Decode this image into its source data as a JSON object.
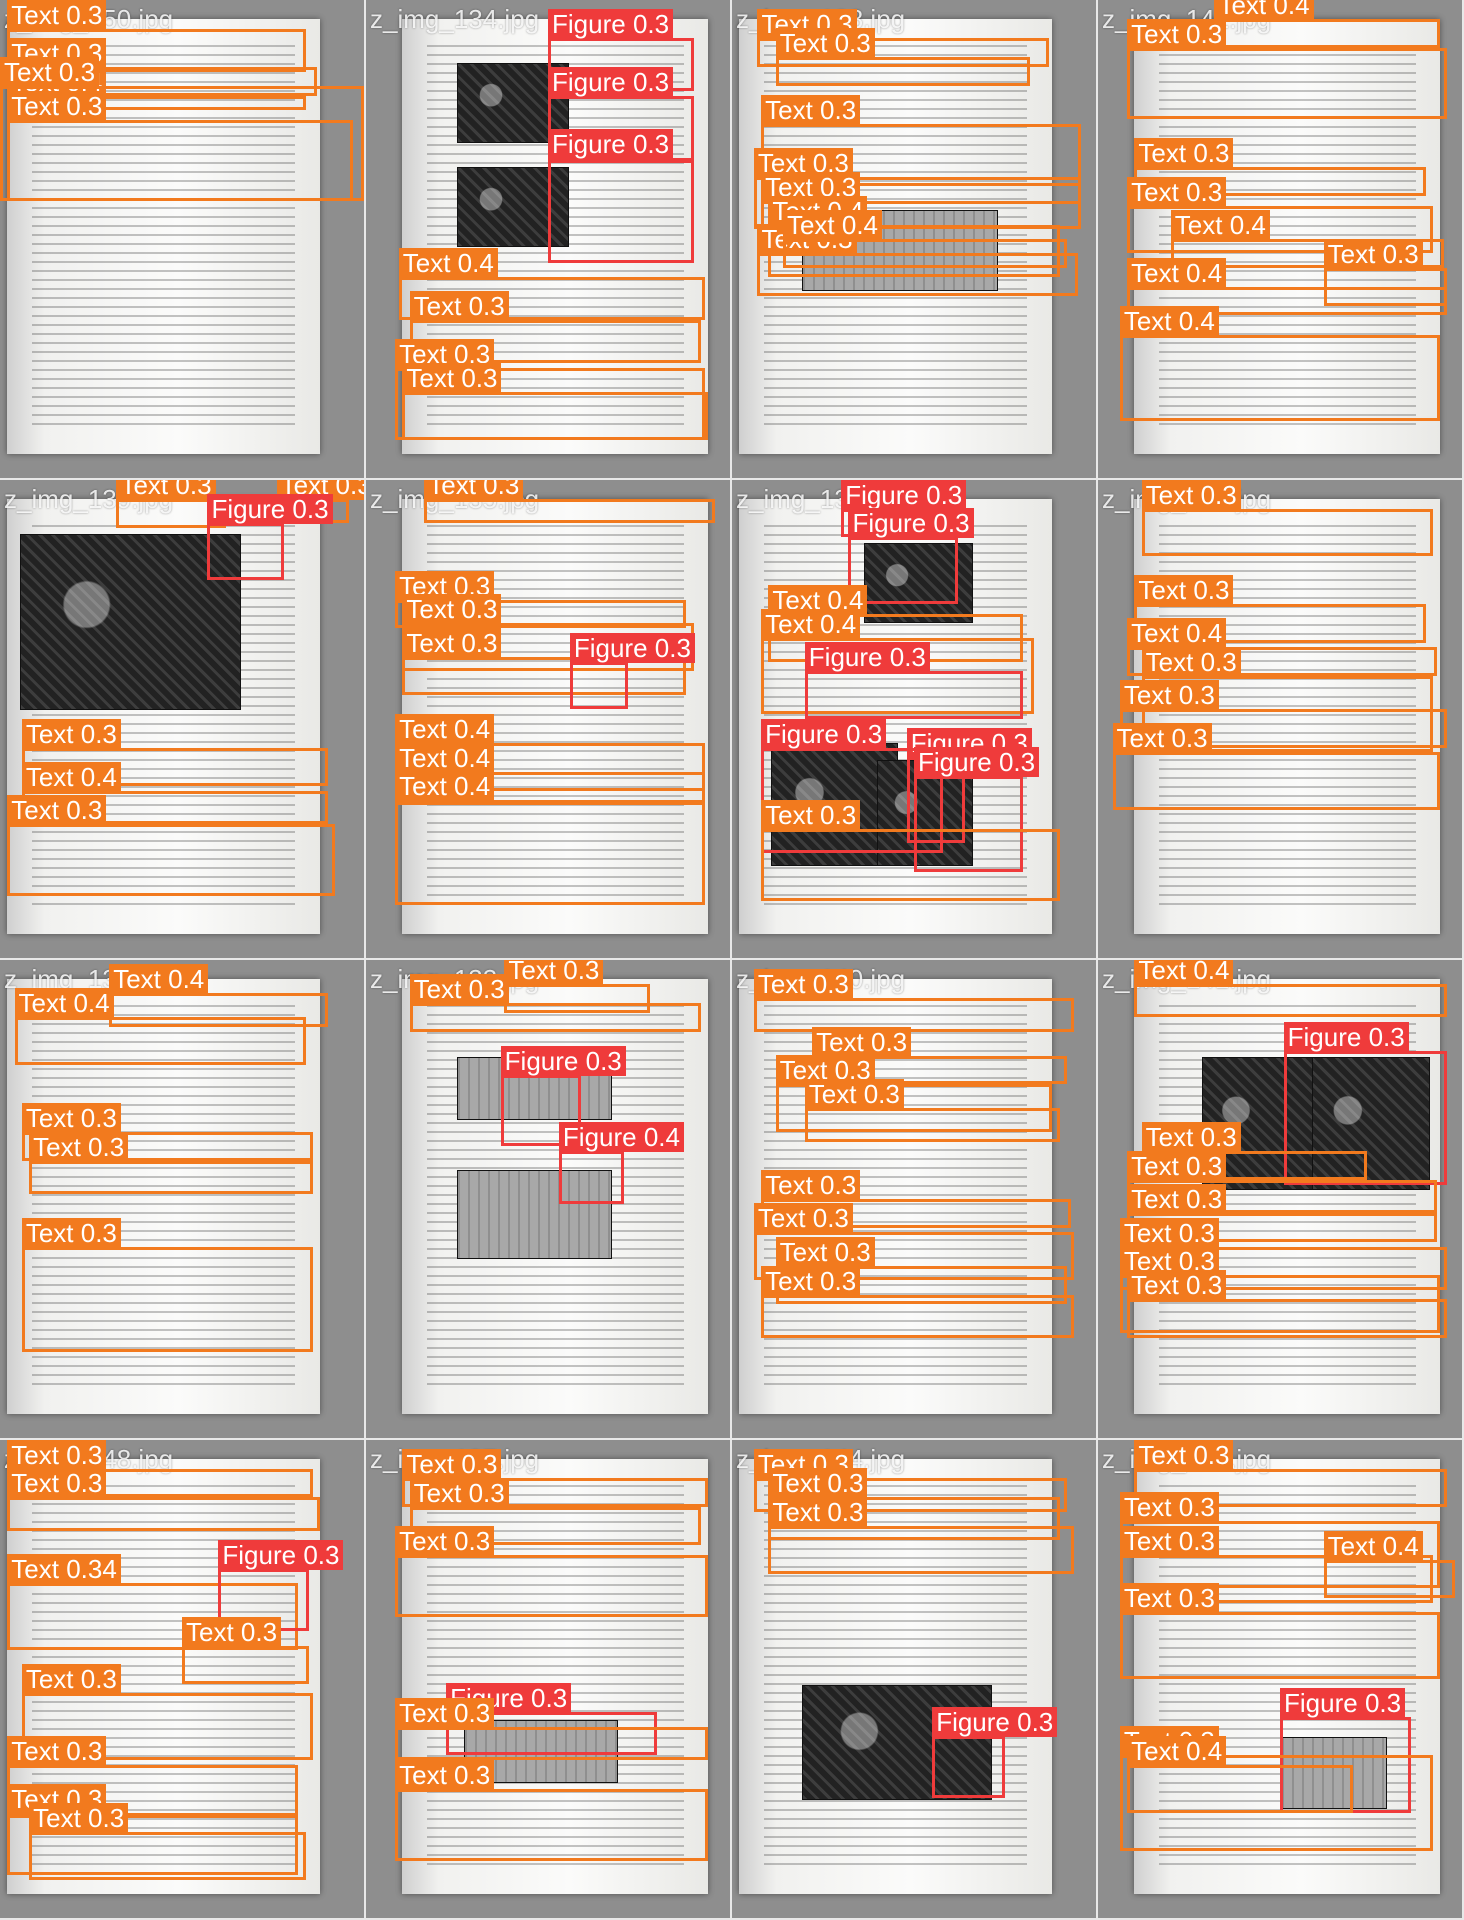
{
  "mosaic": {
    "tiles": [
      {
        "title": "z_img_150.jpg",
        "page_side": "left",
        "photos": [],
        "detections": [
          {
            "label": "Text",
            "score": "0.3"
          },
          {
            "label": "Text",
            "score": "0.3"
          },
          {
            "label": "Text",
            "score": "0.4"
          },
          {
            "label": "Text",
            "score": "0.3"
          },
          {
            "label": "Text",
            "score": "0.3"
          }
        ]
      },
      {
        "title": "z_img_134.jpg",
        "page_side": "right",
        "photos": [
          "dark",
          "dark"
        ],
        "detections": [
          {
            "label": "Figure",
            "score": "0.3"
          },
          {
            "label": "Figure",
            "score": "0.3"
          },
          {
            "label": "Figure",
            "score": "0.3"
          },
          {
            "label": "Text",
            "score": "0.4"
          },
          {
            "label": "Text",
            "score": "0.3"
          },
          {
            "label": "Text",
            "score": "0.3"
          },
          {
            "label": "Text",
            "score": "0.3"
          }
        ]
      },
      {
        "title": "z_img_138.jpg",
        "page_side": "left",
        "photos": [
          "light"
        ],
        "detections": [
          {
            "label": "Text",
            "score": "0.3"
          },
          {
            "label": "Text",
            "score": "0.3"
          },
          {
            "label": "Text",
            "score": "0.3"
          },
          {
            "label": "Text",
            "score": "0.3"
          },
          {
            "label": "Text",
            "score": "0.3"
          },
          {
            "label": "Text",
            "score": "0.4"
          },
          {
            "label": "Text",
            "score": "0.3"
          },
          {
            "label": "Text",
            "score": "0.4"
          }
        ]
      },
      {
        "title": "z_img_142.jpg",
        "page_side": "right",
        "photos": [],
        "detections": [
          {
            "label": "Text",
            "score": "0.4"
          },
          {
            "label": "Text",
            "score": "0.3"
          },
          {
            "label": "Text",
            "score": "0.3"
          },
          {
            "label": "Text",
            "score": "0.3"
          },
          {
            "label": "Text",
            "score": "0.4"
          },
          {
            "label": "Text",
            "score": "0.3"
          },
          {
            "label": "Text",
            "score": "0.4"
          },
          {
            "label": "Text",
            "score": "0.4"
          }
        ]
      },
      {
        "title": "z_img_139.jpg",
        "page_side": "left",
        "photos": [
          "dark"
        ],
        "detections": [
          {
            "label": "Text",
            "score": "0.3"
          },
          {
            "label": "Text",
            "score": "0.3"
          },
          {
            "label": "Figure",
            "score": "0.3"
          },
          {
            "label": "Text",
            "score": "0.3"
          },
          {
            "label": "Text",
            "score": "0.4"
          },
          {
            "label": "Text",
            "score": "0.3"
          }
        ]
      },
      {
        "title": "z_img_135.jpg",
        "page_side": "right",
        "photos": [],
        "detections": [
          {
            "label": "Text",
            "score": "0.3"
          },
          {
            "label": "Text",
            "score": "0.3"
          },
          {
            "label": "Text",
            "score": "0.3"
          },
          {
            "label": "Text",
            "score": "0.3"
          },
          {
            "label": "Text",
            "score": "0.4"
          },
          {
            "label": "Figure",
            "score": "0.3"
          },
          {
            "label": "Text",
            "score": "0.4"
          },
          {
            "label": "Text",
            "score": "0.4"
          }
        ]
      },
      {
        "title": "z_img_136.jpg",
        "page_side": "left",
        "photos": [
          "dark",
          "dark",
          "dark"
        ],
        "detections": [
          {
            "label": "Figure",
            "score": "0.3"
          },
          {
            "label": "Figure",
            "score": "0.3"
          },
          {
            "label": "Text",
            "score": "0.4"
          },
          {
            "label": "Text",
            "score": "0.4"
          },
          {
            "label": "Figure",
            "score": "0.3"
          },
          {
            "label": "Figure",
            "score": "0.3"
          },
          {
            "label": "Figure",
            "score": "0.3"
          },
          {
            "label": "Figure",
            "score": "0.3"
          },
          {
            "label": "Text",
            "score": "0.3"
          }
        ]
      },
      {
        "title": "z_img_143.jpg",
        "page_side": "right",
        "photos": [],
        "detections": [
          {
            "label": "Text",
            "score": "0.3"
          },
          {
            "label": "Text",
            "score": "0.3"
          },
          {
            "label": "Text",
            "score": "0.4"
          },
          {
            "label": "Text",
            "score": "0.3"
          },
          {
            "label": "Text",
            "score": "0.3"
          },
          {
            "label": "Text",
            "score": "0.3"
          }
        ]
      },
      {
        "title": "z_img_132.jpg",
        "page_side": "left",
        "photos": [],
        "detections": [
          {
            "label": "Text",
            "score": "0.4"
          },
          {
            "label": "Text",
            "score": "0.4"
          },
          {
            "label": "Text",
            "score": "0.3"
          },
          {
            "label": "Text",
            "score": "0.3"
          },
          {
            "label": "Text",
            "score": "0.3"
          }
        ]
      },
      {
        "title": "z_img_133.jpg",
        "page_side": "right",
        "photos": [
          "light",
          "light"
        ],
        "detections": [
          {
            "label": "Text",
            "score": "0.3"
          },
          {
            "label": "Text",
            "score": "0.3"
          },
          {
            "label": "Figure",
            "score": "0.3"
          },
          {
            "label": "Figure",
            "score": "0.4"
          }
        ]
      },
      {
        "title": "z_img_140.jpg",
        "page_side": "left",
        "photos": [],
        "detections": [
          {
            "label": "Text",
            "score": "0.3"
          },
          {
            "label": "Text",
            "score": "0.3"
          },
          {
            "label": "Text",
            "score": "0.3"
          },
          {
            "label": "Text",
            "score": "0.3"
          },
          {
            "label": "Text",
            "score": "0.3"
          },
          {
            "label": "Text",
            "score": "0.3"
          },
          {
            "label": "Text",
            "score": "0.3"
          },
          {
            "label": "Text",
            "score": "0.3"
          }
        ]
      },
      {
        "title": "z_img_141.jpg",
        "page_side": "right",
        "photos": [
          "dark",
          "dark"
        ],
        "detections": [
          {
            "label": "Text",
            "score": "0.4"
          },
          {
            "label": "Figure",
            "score": "0.3"
          },
          {
            "label": "Text",
            "score": "0.3"
          },
          {
            "label": "Text",
            "score": "0.3"
          },
          {
            "label": "Text",
            "score": "0.3"
          },
          {
            "label": "Text",
            "score": "0.3"
          },
          {
            "label": "Text",
            "score": "0.3"
          },
          {
            "label": "Text",
            "score": "0.3"
          }
        ]
      },
      {
        "title": "z_img_148.jpg",
        "page_side": "left",
        "photos": [],
        "detections": [
          {
            "label": "Text",
            "score": "0.3"
          },
          {
            "label": "Text",
            "score": "0.3"
          },
          {
            "label": "Text",
            "score": "0.34"
          },
          {
            "label": "Figure",
            "score": "0.3"
          },
          {
            "label": "Text",
            "score": "0.3"
          },
          {
            "label": "Text",
            "score": "0.3"
          },
          {
            "label": "Text",
            "score": "0.3"
          },
          {
            "label": "Text",
            "score": "0.3"
          },
          {
            "label": "Text",
            "score": "0.3"
          }
        ]
      },
      {
        "title": "z_img_137.jpg",
        "page_side": "right",
        "photos": [
          "light"
        ],
        "detections": [
          {
            "label": "Text",
            "score": "0.3"
          },
          {
            "label": "Text",
            "score": "0.3"
          },
          {
            "label": "Text",
            "score": "0.3"
          },
          {
            "label": "Figure",
            "score": "0.3"
          },
          {
            "label": "Text",
            "score": "0.3"
          },
          {
            "label": "Text",
            "score": "0.3"
          }
        ]
      },
      {
        "title": "z_img_144.jpg",
        "page_side": "left",
        "photos": [
          "dark"
        ],
        "detections": [
          {
            "label": "Text",
            "score": "0.3"
          },
          {
            "label": "Text",
            "score": "0.3"
          },
          {
            "label": "Text",
            "score": "0.3"
          },
          {
            "label": "Figure",
            "score": "0.3"
          }
        ]
      },
      {
        "title": "z_img_145.jpg",
        "page_side": "right",
        "photos": [
          "light"
        ],
        "detections": [
          {
            "label": "Text",
            "score": "0.3"
          },
          {
            "label": "Text",
            "score": "0.3"
          },
          {
            "label": "Text",
            "score": "0.3"
          },
          {
            "label": "Text",
            "score": "0.4"
          },
          {
            "label": "Text",
            "score": "0.3"
          },
          {
            "label": "Figure",
            "score": "0.3"
          },
          {
            "label": "Text",
            "score": "0.3"
          },
          {
            "label": "Text",
            "score": "0.4"
          }
        ]
      }
    ]
  },
  "colors": {
    "text_box": "#f27a1e",
    "figure_box": "#ef3b3b",
    "label_text": "#ffffff",
    "background": "#8e8e8e"
  }
}
